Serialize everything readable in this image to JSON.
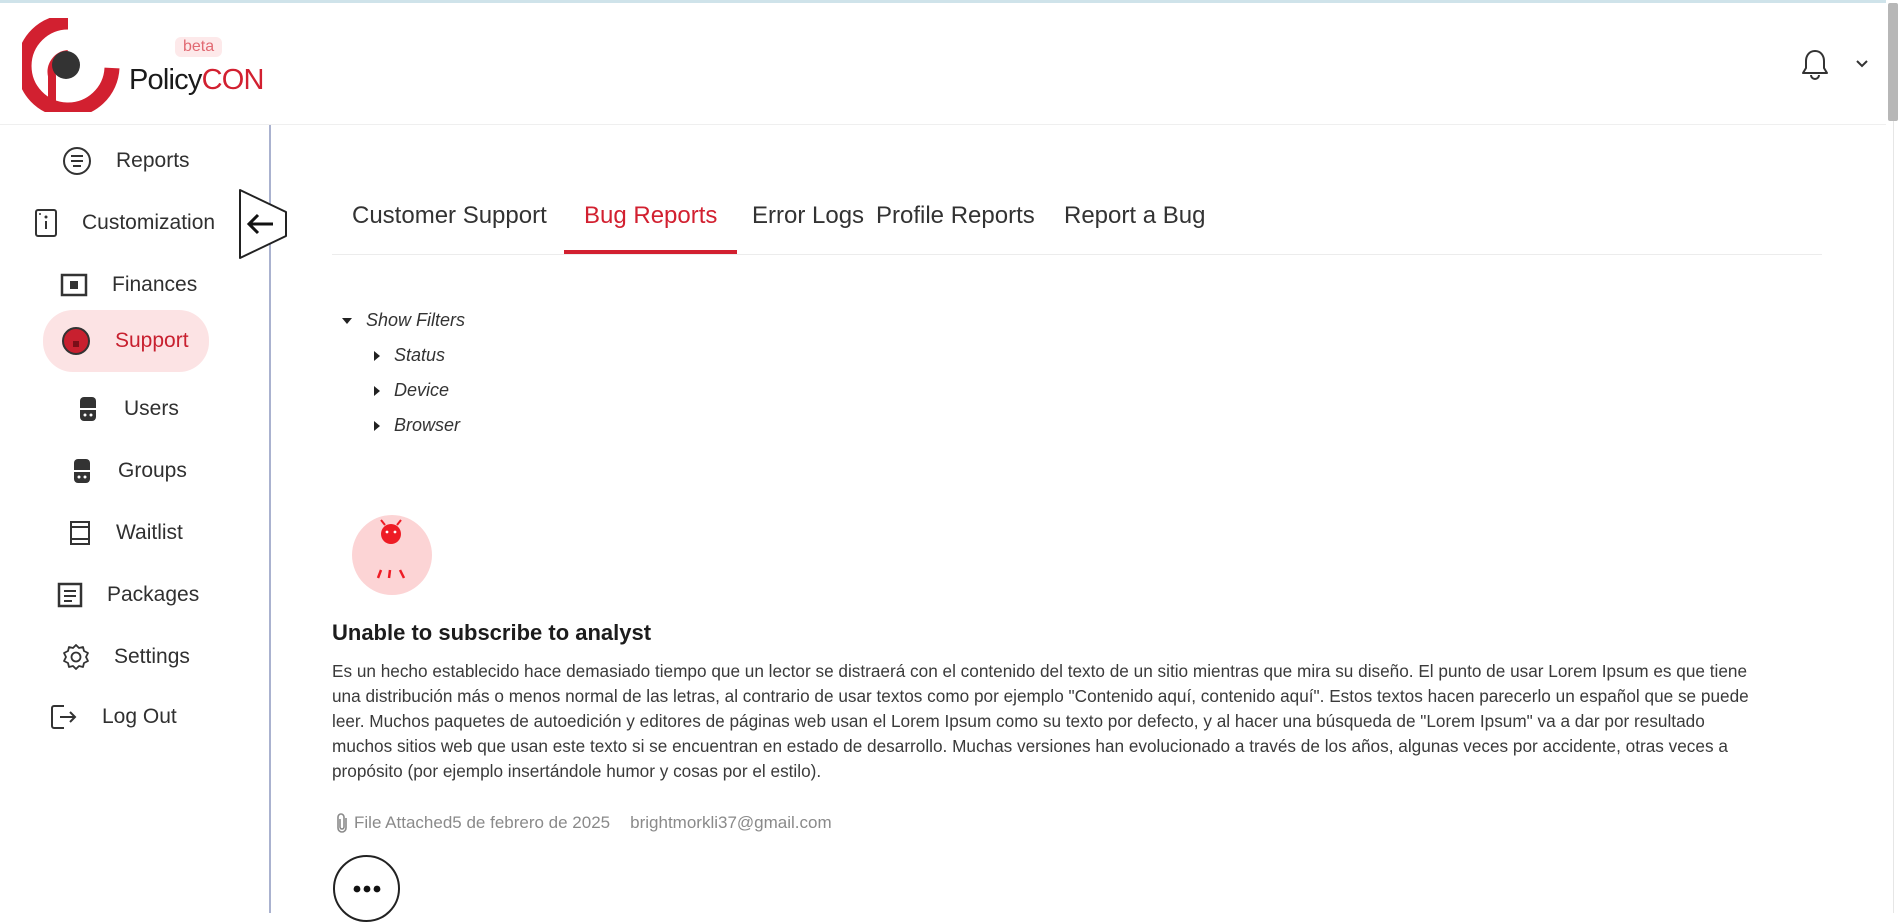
{
  "app": {
    "logo_text_primary": "Policy",
    "logo_text_accent": "CON",
    "badge": "beta",
    "brand_color": "#d22030"
  },
  "header": {
    "notification_icon": "bell-icon",
    "menu_icon": "chevron-down-icon"
  },
  "sidebar": {
    "items": [
      {
        "label": "Reports",
        "icon": "list-circle-icon"
      },
      {
        "label": "Customization",
        "icon": "card-icon"
      },
      {
        "label": "Finances",
        "icon": "wallet-icon"
      },
      {
        "label": "Support",
        "icon": "support-icon",
        "active": true
      },
      {
        "label": "Users",
        "icon": "users-icon"
      },
      {
        "label": "Groups",
        "icon": "groups-icon"
      },
      {
        "label": "Waitlist",
        "icon": "book-icon"
      },
      {
        "label": "Packages",
        "icon": "document-icon"
      },
      {
        "label": "Settings",
        "icon": "gear-icon"
      },
      {
        "label": "Log Out",
        "icon": "logout-icon"
      }
    ],
    "collapse_icon": "arrow-left-icon"
  },
  "tabs": [
    {
      "label": "Customer Support"
    },
    {
      "label": "Bug Reports",
      "active": true
    },
    {
      "label": "Error Logs"
    },
    {
      "label": "Profile Reports"
    },
    {
      "label": "Report a Bug"
    }
  ],
  "filters": {
    "toggle_label": "Show Filters",
    "items": [
      "Status",
      "Device",
      "Browser"
    ]
  },
  "report": {
    "avatar_icon": "bug-icon",
    "title": "Unable to subscribe to analyst",
    "body": "Es un hecho establecido hace demasiado tiempo que un lector se distraerá con el contenido del texto de un sitio mientras que mira su diseño. El punto de usar Lorem Ipsum es que tiene una distribución más o menos normal de las letras, al contrario de usar textos como por ejemplo \"Contenido aquí, contenido aquí\". Estos textos hacen parecerlo un español que se puede leer. Muchos paquetes de autoedición y editores de páginas web usan el Lorem Ipsum como su texto por defecto, y al hacer una búsqueda de \"Lorem Ipsum\" va a dar por resultado muchos sitios web que usan este texto si se encuentran en estado de desarrollo. Muchas versiones han evolucionado a través de los años, algunas veces por accidente, otras veces a propósito (por ejemplo insertándole humor y cosas por el estilo).",
    "attachment_label": "File Attached",
    "date": "5 de febrero de 2025",
    "email": "brightmorkli37@gmail.com",
    "more_icon": "more-dots-icon"
  }
}
